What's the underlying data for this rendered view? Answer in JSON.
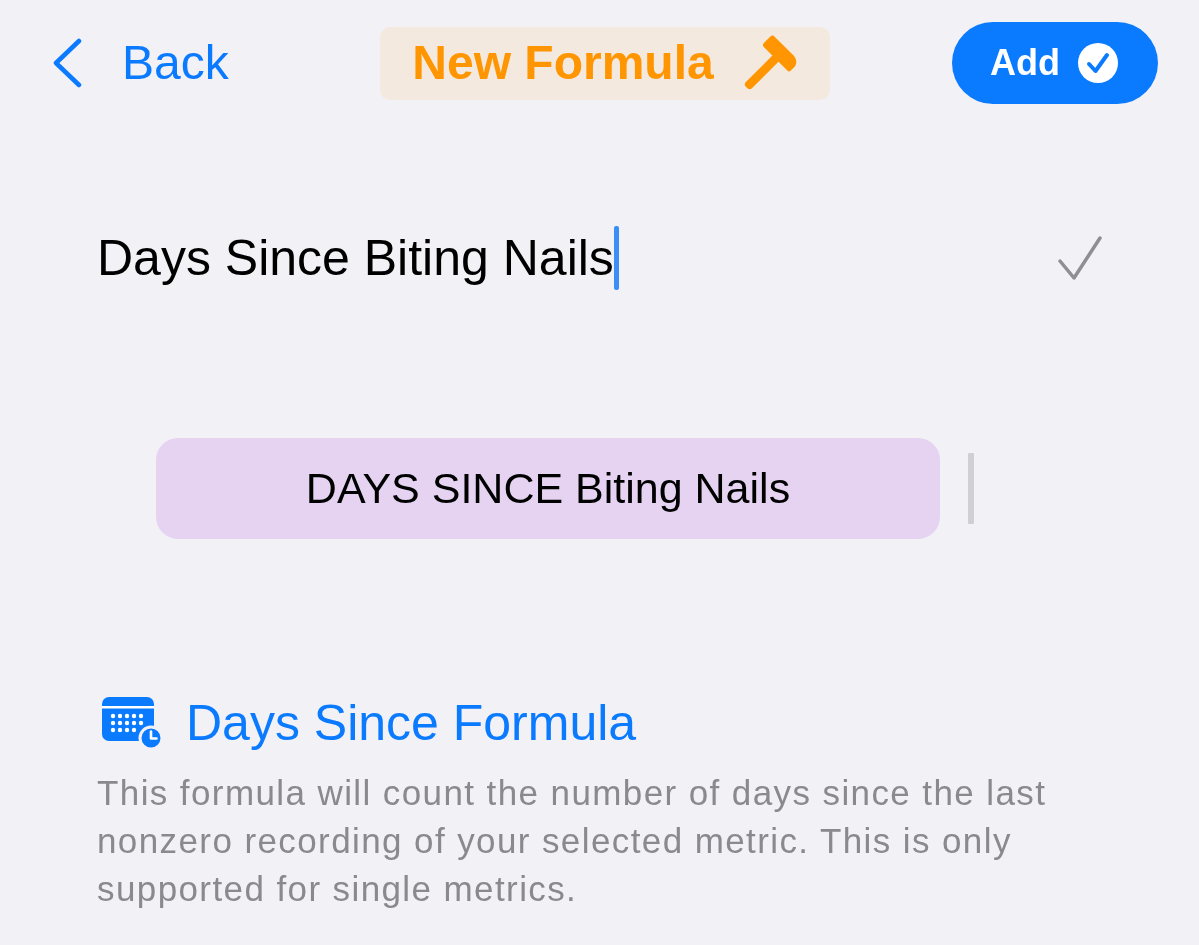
{
  "nav_bar": {
    "back_button": {
      "label": "Back"
    },
    "title": "New Formula",
    "add_button": {
      "label": "Add"
    }
  },
  "name_field": {
    "value": "Days Since Biting Nails",
    "focused": true
  },
  "formula_field": {
    "token": "DAYS SINCE Biting Nails",
    "focused": false
  },
  "formula_info": {
    "title": "Days Since Formula",
    "description": "This formula will count the number of days since the last nonzero recording of your selected metric. This is only supported for single metrics."
  }
}
